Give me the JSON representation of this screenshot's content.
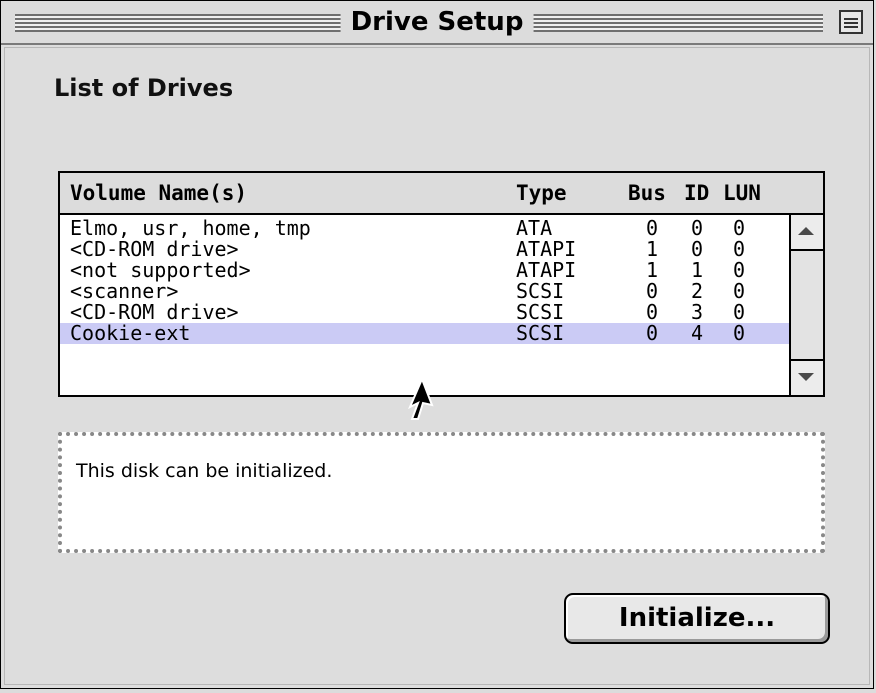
{
  "window": {
    "title": "Drive Setup"
  },
  "section": {
    "title": "List of Drives"
  },
  "table": {
    "headers": {
      "name": "Volume Name(s)",
      "type": "Type",
      "bus": "Bus",
      "id": "ID",
      "lun": "LUN"
    },
    "rows": [
      {
        "name": "Elmo, usr, home, tmp",
        "type": "ATA",
        "bus": "0",
        "id": "0",
        "lun": "0"
      },
      {
        "name": "<CD-ROM drive>",
        "type": "ATAPI",
        "bus": "1",
        "id": "0",
        "lun": "0"
      },
      {
        "name": "<not supported>",
        "type": "ATAPI",
        "bus": "1",
        "id": "1",
        "lun": "0"
      },
      {
        "name": "<scanner>",
        "type": "SCSI",
        "bus": "0",
        "id": "2",
        "lun": "0"
      },
      {
        "name": "<CD-ROM drive>",
        "type": "SCSI",
        "bus": "0",
        "id": "3",
        "lun": "0"
      },
      {
        "name": "Cookie-ext",
        "type": "SCSI",
        "bus": "0",
        "id": "4",
        "lun": "0"
      }
    ],
    "selected_index": 5
  },
  "message": {
    "text": "This disk can be initialized."
  },
  "buttons": {
    "initialize": "Initialize..."
  },
  "colors": {
    "selection": "#cbcbf5",
    "window_bg": "#dddddd"
  }
}
